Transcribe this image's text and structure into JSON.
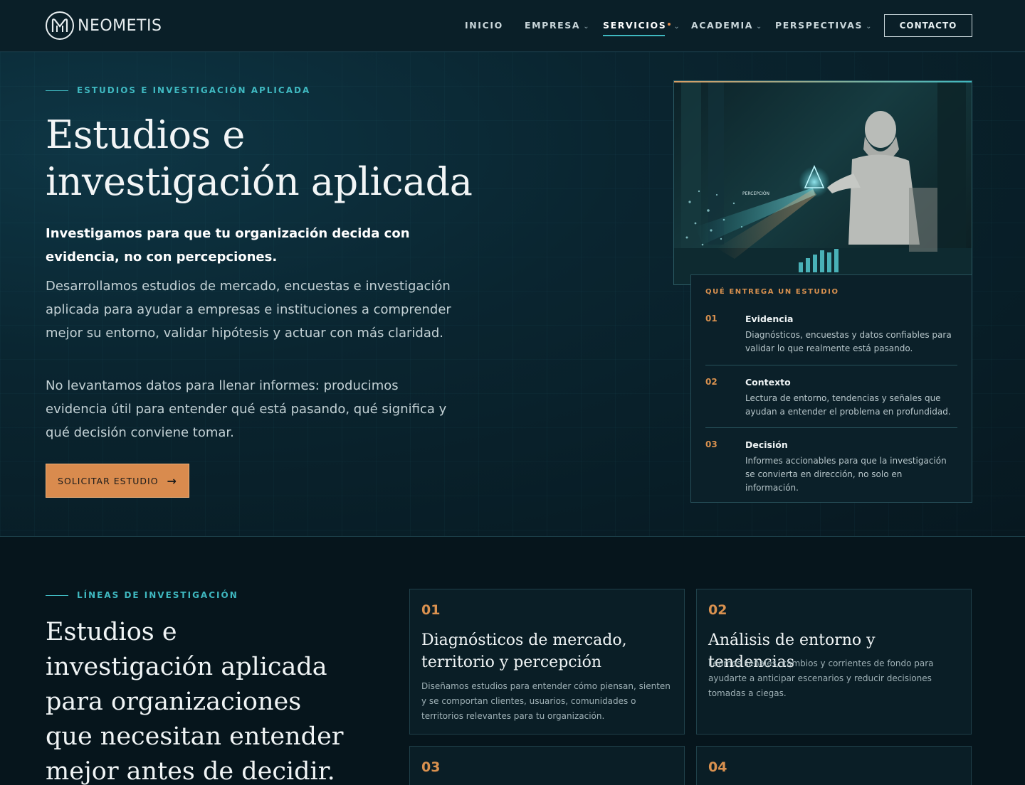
{
  "header": {
    "brand": "NEOMETIS",
    "nav": [
      {
        "label": "INICIO"
      },
      {
        "label": "EMPRESA"
      },
      {
        "label": "SERVICIOS"
      },
      {
        "label": "ACADEMIA"
      },
      {
        "label": "PERSPECTIVAS"
      }
    ],
    "contact_label": "CONTACTO"
  },
  "hero": {
    "eyebrow": "ESTUDIOS E INVESTIGACIÓN APLICADA",
    "title": "Estudios e investigación aplicada",
    "lead": "Investigamos para que tu organización decida con evidencia, no con percepciones.",
    "paragraph1": "Desarrollamos estudios de mercado, encuestas e investigación aplicada para ayudar a empresas e instituciones a comprender mejor su entorno, validar hipótesis y actuar con más claridad.",
    "paragraph2": "No levantamos datos para llenar informes: producimos evidencia útil para entender qué está pasando, qué significa y qué decisión conviene tomar.",
    "cta_label": "SOLICITAR ESTUDIO",
    "image_label": "PERCEPCIÓN"
  },
  "deliverables": {
    "heading": "QUÉ ENTREGA UN ESTUDIO",
    "items": [
      {
        "num": "01",
        "title": "Evidencia",
        "text": "Diagnósticos, encuestas y datos confiables para validar lo que realmente está pasando."
      },
      {
        "num": "02",
        "title": "Contexto",
        "text": "Lectura de entorno, tendencias y señales que ayudan a entender el problema en profundidad."
      },
      {
        "num": "03",
        "title": "Decisión",
        "text": "Informes accionables para que la investigación se convierta en dirección, no solo en información."
      }
    ]
  },
  "lines": {
    "eyebrow": "LÍNEAS DE INVESTIGACIÓN",
    "title": "Estudios e investigación aplicada para organizaciones que necesitan entender mejor antes de decidir.",
    "cards": [
      {
        "num": "01",
        "title": "Diagnósticos de mercado, territorio y percepción",
        "text": "Diseñamos estudios para entender cómo piensan, sienten y se comportan clientes, usuarios, comunidades o territorios relevantes para tu organización."
      },
      {
        "num": "02",
        "title": "Análisis de entorno y tendencias",
        "text": "Leemos señales, cambios y corrientes de fondo para ayudarte a anticipar escenarios y reducir decisiones tomadas a ciegas."
      },
      {
        "num": "03"
      },
      {
        "num": "04"
      }
    ]
  },
  "colors": {
    "accent_teal": "#3fb8c0",
    "accent_orange": "#d9914f",
    "background": "#06151c"
  }
}
